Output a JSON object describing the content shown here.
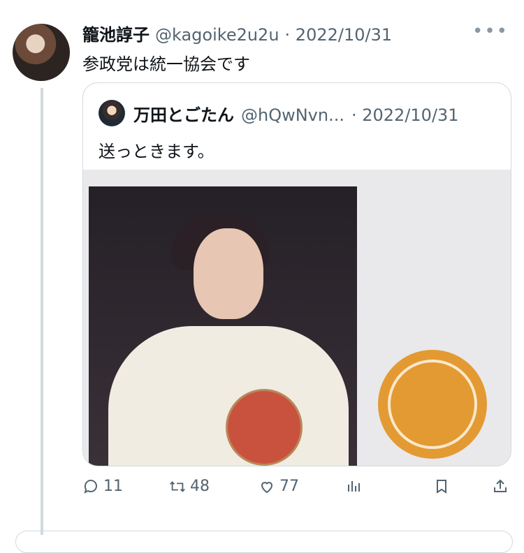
{
  "tweet": {
    "author_name": "籠池諄子",
    "handle": "@kagoike2u2u",
    "date": "· 2022/10/31",
    "text": "参政党は統一協会です",
    "more_icon": "more-icon"
  },
  "quote": {
    "author_name": "万田とごたん",
    "handle": "@hQwNvn...",
    "date": "· 2022/10/31",
    "text": "送っときます。"
  },
  "actions": {
    "replies": "11",
    "retweets": "48",
    "likes": "77"
  },
  "colors": {
    "text": "#0f1419",
    "secondary": "#536471",
    "border": "#cfd9de"
  }
}
